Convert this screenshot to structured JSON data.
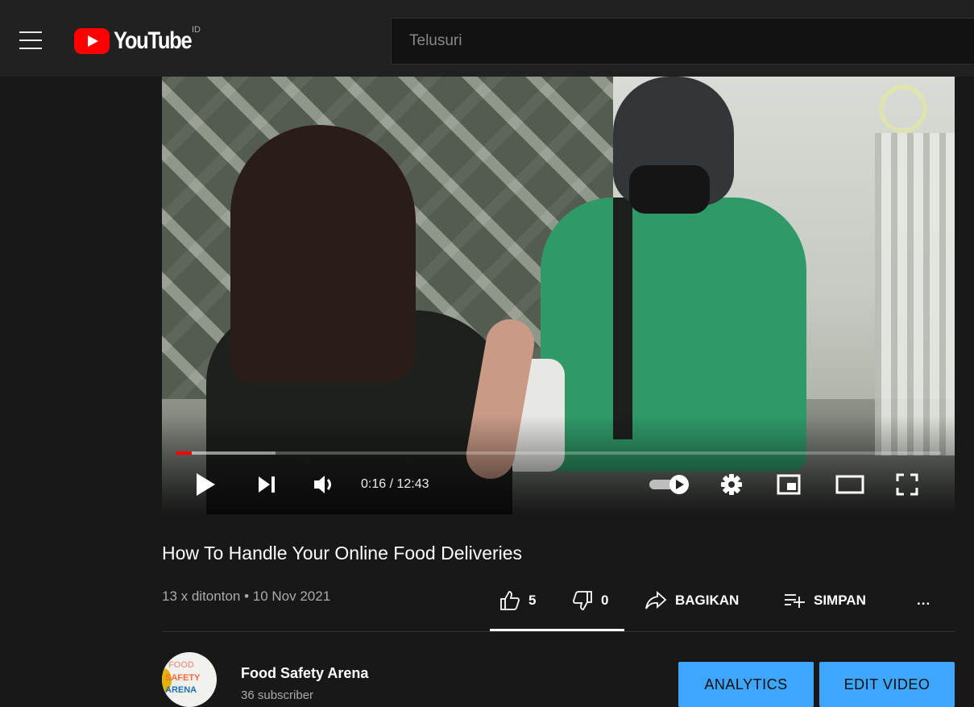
{
  "header": {
    "logo_text": "YouTube",
    "country_code": "ID",
    "search_placeholder": "Telusuri"
  },
  "player": {
    "current_time": "0:16",
    "separator": " / ",
    "duration": "12:43",
    "progress_fraction": 0.021,
    "buffer_fraction": 0.13,
    "state": "paused",
    "autoplay": "on"
  },
  "video": {
    "title": "How To Handle Your Online Food Deliveries",
    "views": "13 x ditonton",
    "dot": " • ",
    "date": "10 Nov 2021"
  },
  "actions": {
    "likes": "5",
    "dislikes": "0",
    "share_label": "BAGIKAN",
    "save_label": "SIMPAN",
    "more_label": "..."
  },
  "channel": {
    "name": "Food Safety Arena",
    "subscribers": "36 subscriber",
    "avatar_lines": [
      "FOOD",
      "SAFETY",
      "ARENA"
    ]
  },
  "buttons": {
    "analytics": "ANALYTICS",
    "edit_video": "EDIT VIDEO"
  },
  "colors": {
    "accent_blue": "#3ea6ff",
    "brand_red": "#ff0000",
    "background": "#181818"
  }
}
